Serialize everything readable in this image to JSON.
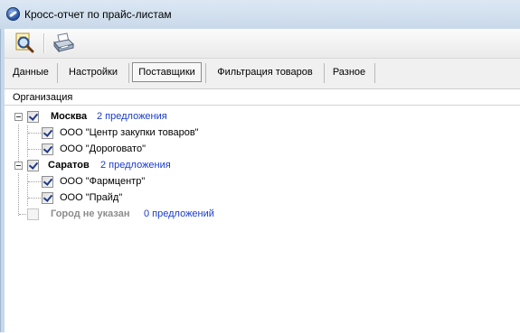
{
  "window": {
    "title": "Кросс-отчет по прайс-листам"
  },
  "toolbar": {
    "icons": [
      "magnifier-icon",
      "printer-icon"
    ]
  },
  "tabs": [
    {
      "label": "Данные",
      "active": false
    },
    {
      "label": "Настройки",
      "active": false
    },
    {
      "label": "Поставщики",
      "active": true
    },
    {
      "label": "Фильтрация товаров",
      "active": false
    },
    {
      "label": "Разное",
      "active": false
    }
  ],
  "tree": {
    "column_header": "Организация",
    "groups": [
      {
        "city": "Москва",
        "offers": "2 предложения",
        "checked": true,
        "items": [
          {
            "name": "ООО \"Центр закупки товаров\"",
            "checked": true
          },
          {
            "name": "ООО \"Дороговато\"",
            "checked": true
          }
        ]
      },
      {
        "city": "Саратов",
        "offers": "2 предложения",
        "checked": true,
        "items": [
          {
            "name": "ООО \"Фармцентр\"",
            "checked": true
          },
          {
            "name": "ООО \"Прайд\"",
            "checked": true
          }
        ]
      },
      {
        "city": "Город не указан",
        "offers": "0 предложений",
        "checked": false,
        "items": []
      }
    ]
  },
  "colors": {
    "link_blue": "#1a3cc8",
    "disabled_gray": "#8c8c8c",
    "titlebar": "#c9d9ea"
  }
}
